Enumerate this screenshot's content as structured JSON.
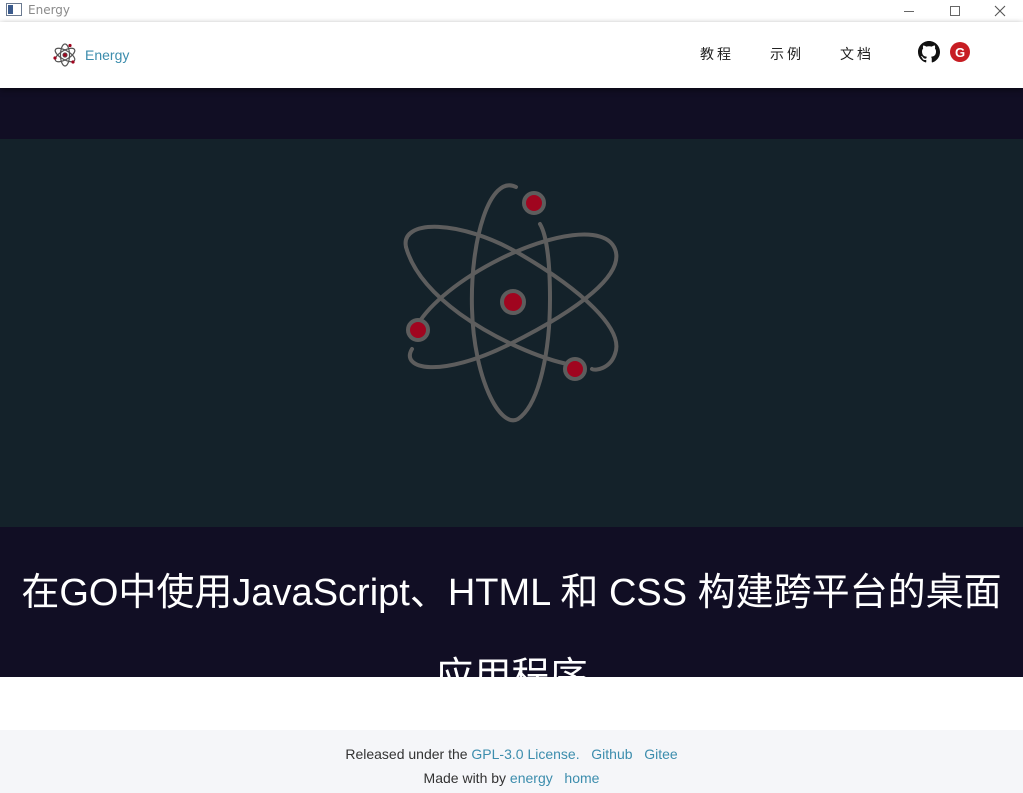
{
  "window": {
    "title": "Energy",
    "icon": "app-window-icon"
  },
  "navbar": {
    "brand_name": "Energy",
    "brand_icon": "atom-icon",
    "links": [
      {
        "label": "教程"
      },
      {
        "label": "示例"
      },
      {
        "label": "文档"
      }
    ],
    "social": {
      "github_icon": "github-icon",
      "gitee_icon": "gitee-icon",
      "gitee_letter": "G"
    }
  },
  "hero": {
    "image_icon": "atom-icon",
    "title": "在GO中使用JavaScript、HTML 和 CSS 构建跨平台的桌面应用程序"
  },
  "footer": {
    "line1_prefix": "Released under the",
    "license_link": "GPL-3.0 License.",
    "github_link": "Github",
    "gitee_link": "Gitee",
    "line2_prefix": "Made with by",
    "energy_link": "energy",
    "home_link": "home"
  },
  "colors": {
    "accent": "#3c8dad",
    "hero_dark": "#110e24",
    "hero_image_bg": "#14222a",
    "atom_orbit": "#5d5d5d",
    "atom_electron": "#a0051f",
    "gitee_red": "#c71d23",
    "footer_bg": "#f5f6f9"
  }
}
